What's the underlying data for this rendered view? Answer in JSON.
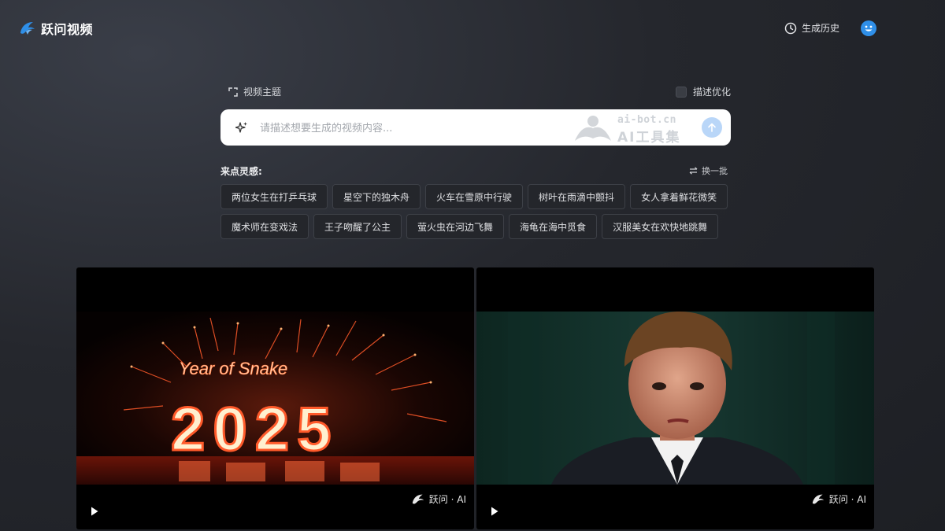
{
  "app": {
    "name": "跃问视频"
  },
  "header": {
    "history_label": "生成历史"
  },
  "options": {
    "theme_label": "视频主题",
    "optimize_label": "描述优化"
  },
  "search": {
    "placeholder": "请描述想要生成的视频内容..."
  },
  "watermark": {
    "url": "ai-bot.cn",
    "name": "AI工具集"
  },
  "inspiration": {
    "title": "来点灵感:",
    "refresh_label": "换一批",
    "row1": [
      "两位女生在打乒乓球",
      "星空下的独木舟",
      "火车在雪原中行驶",
      "树叶在雨滴中颤抖",
      "女人拿着鲜花微笑"
    ],
    "row2": [
      "魔术师在变戏法",
      "王子吻醒了公主",
      "萤火虫在河边飞舞",
      "海龟在海中觅食",
      "汉服美女在欢快地跳舞"
    ]
  },
  "videos": [
    {
      "overlay_line1": "Year of Snake",
      "overlay_line2": "2025",
      "badge": "跃问 · AI"
    },
    {
      "badge": "跃问 · AI"
    }
  ],
  "colors": {
    "accent": "#2f8fe8",
    "send": "#b9d6f8",
    "background": "#1f2126"
  }
}
